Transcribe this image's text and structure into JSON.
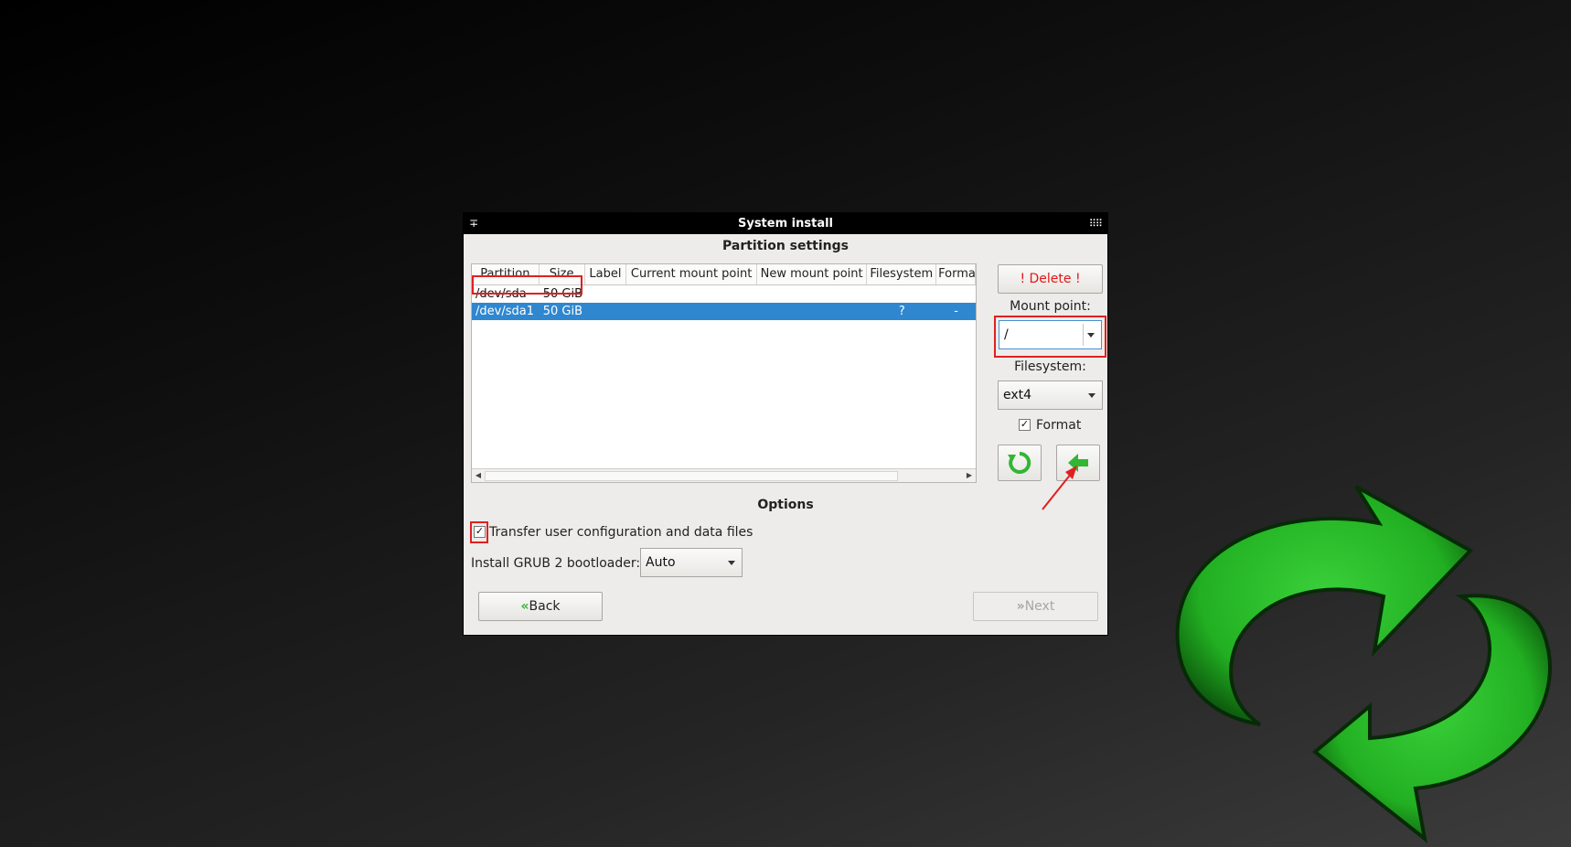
{
  "window": {
    "title": "System install",
    "section_partition": "Partition settings",
    "section_options": "Options"
  },
  "table": {
    "columns": [
      "Partition",
      "Size",
      "Label",
      "Current mount point",
      "New mount point",
      "Filesystem",
      "Format"
    ],
    "rows": [
      {
        "partition": "/dev/sda",
        "size": "50 GiB",
        "label": "",
        "current_mount": "",
        "new_mount": "",
        "filesystem": "",
        "format": "",
        "selected": false
      },
      {
        "partition": "/dev/sda1",
        "size": "50 GiB",
        "label": "",
        "current_mount": "",
        "new_mount": "",
        "filesystem": "?",
        "format": "-",
        "selected": true
      }
    ]
  },
  "side_panel": {
    "delete_label": "! Delete !",
    "mount_point_label": "Mount point:",
    "mount_point_value": "/",
    "filesystem_label": "Filesystem:",
    "filesystem_value": "ext4",
    "format_label": "Format",
    "format_checked": true
  },
  "options": {
    "transfer_label": "Transfer user configuration and data files",
    "transfer_checked": true,
    "grub_label": "Install GRUB 2 bootloader:",
    "grub_value": "Auto"
  },
  "nav": {
    "back_label": "Back",
    "next_label": "Next"
  },
  "colors": {
    "selection": "#2f87cf",
    "accent_green": "#33b633",
    "highlight_red": "#e02020",
    "delete_text": "#e01818"
  },
  "icons": {
    "refresh": "refresh-icon",
    "apply": "arrow-left-icon",
    "logo": "sync-logo-icon"
  }
}
